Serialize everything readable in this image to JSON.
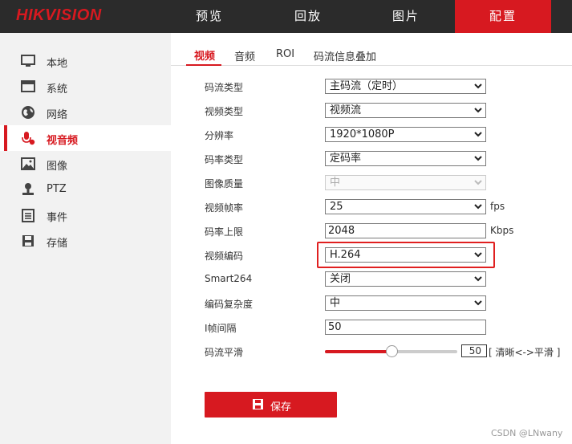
{
  "brand": {
    "logo": "HIKVISION",
    "color": "#d71920"
  },
  "nav": [
    {
      "label": "预览",
      "active": false
    },
    {
      "label": "回放",
      "active": false
    },
    {
      "label": "图片",
      "active": false
    },
    {
      "label": "配置",
      "active": true
    }
  ],
  "sidebar": {
    "items": [
      {
        "label": "本地",
        "icon": "monitor-icon"
      },
      {
        "label": "系统",
        "icon": "window-icon"
      },
      {
        "label": "网络",
        "icon": "globe-icon"
      },
      {
        "label": "视音频",
        "icon": "microphone-icon",
        "active": true
      },
      {
        "label": "图像",
        "icon": "image-icon"
      },
      {
        "label": "PTZ",
        "icon": "ptz-icon"
      },
      {
        "label": "事件",
        "icon": "event-icon"
      },
      {
        "label": "存储",
        "icon": "storage-icon"
      }
    ]
  },
  "tabs": [
    {
      "label": "视频",
      "active": true
    },
    {
      "label": "音频"
    },
    {
      "label": "ROI"
    },
    {
      "label": "码流信息叠加"
    }
  ],
  "form": {
    "stream_type": {
      "label": "码流类型",
      "value": "主码流（定时）"
    },
    "video_type": {
      "label": "视频类型",
      "value": "视频流"
    },
    "resolution": {
      "label": "分辨率",
      "value": "1920*1080P"
    },
    "bitrate_type": {
      "label": "码率类型",
      "value": "定码率"
    },
    "image_quality": {
      "label": "图像质量",
      "value": "中",
      "disabled": true
    },
    "frame_rate": {
      "label": "视频帧率",
      "value": "25",
      "unit": "fps"
    },
    "max_bitrate": {
      "label": "码率上限",
      "value": "2048",
      "unit": "Kbps"
    },
    "video_encoding": {
      "label": "视频编码",
      "value": "H.264",
      "highlighted": true
    },
    "smart264": {
      "label": "Smart264",
      "value": "关闭"
    },
    "encoding_complexity": {
      "label": "编码复杂度",
      "value": "中"
    },
    "i_frame_interval": {
      "label": "I帧间隔",
      "value": "50"
    },
    "stream_smoothing": {
      "label": "码流平滑",
      "value": "50",
      "level": 0.5,
      "hint": "[ 清晰<->平滑 ]"
    }
  },
  "save_label": "保存",
  "watermark": "CSDN @LNwany"
}
